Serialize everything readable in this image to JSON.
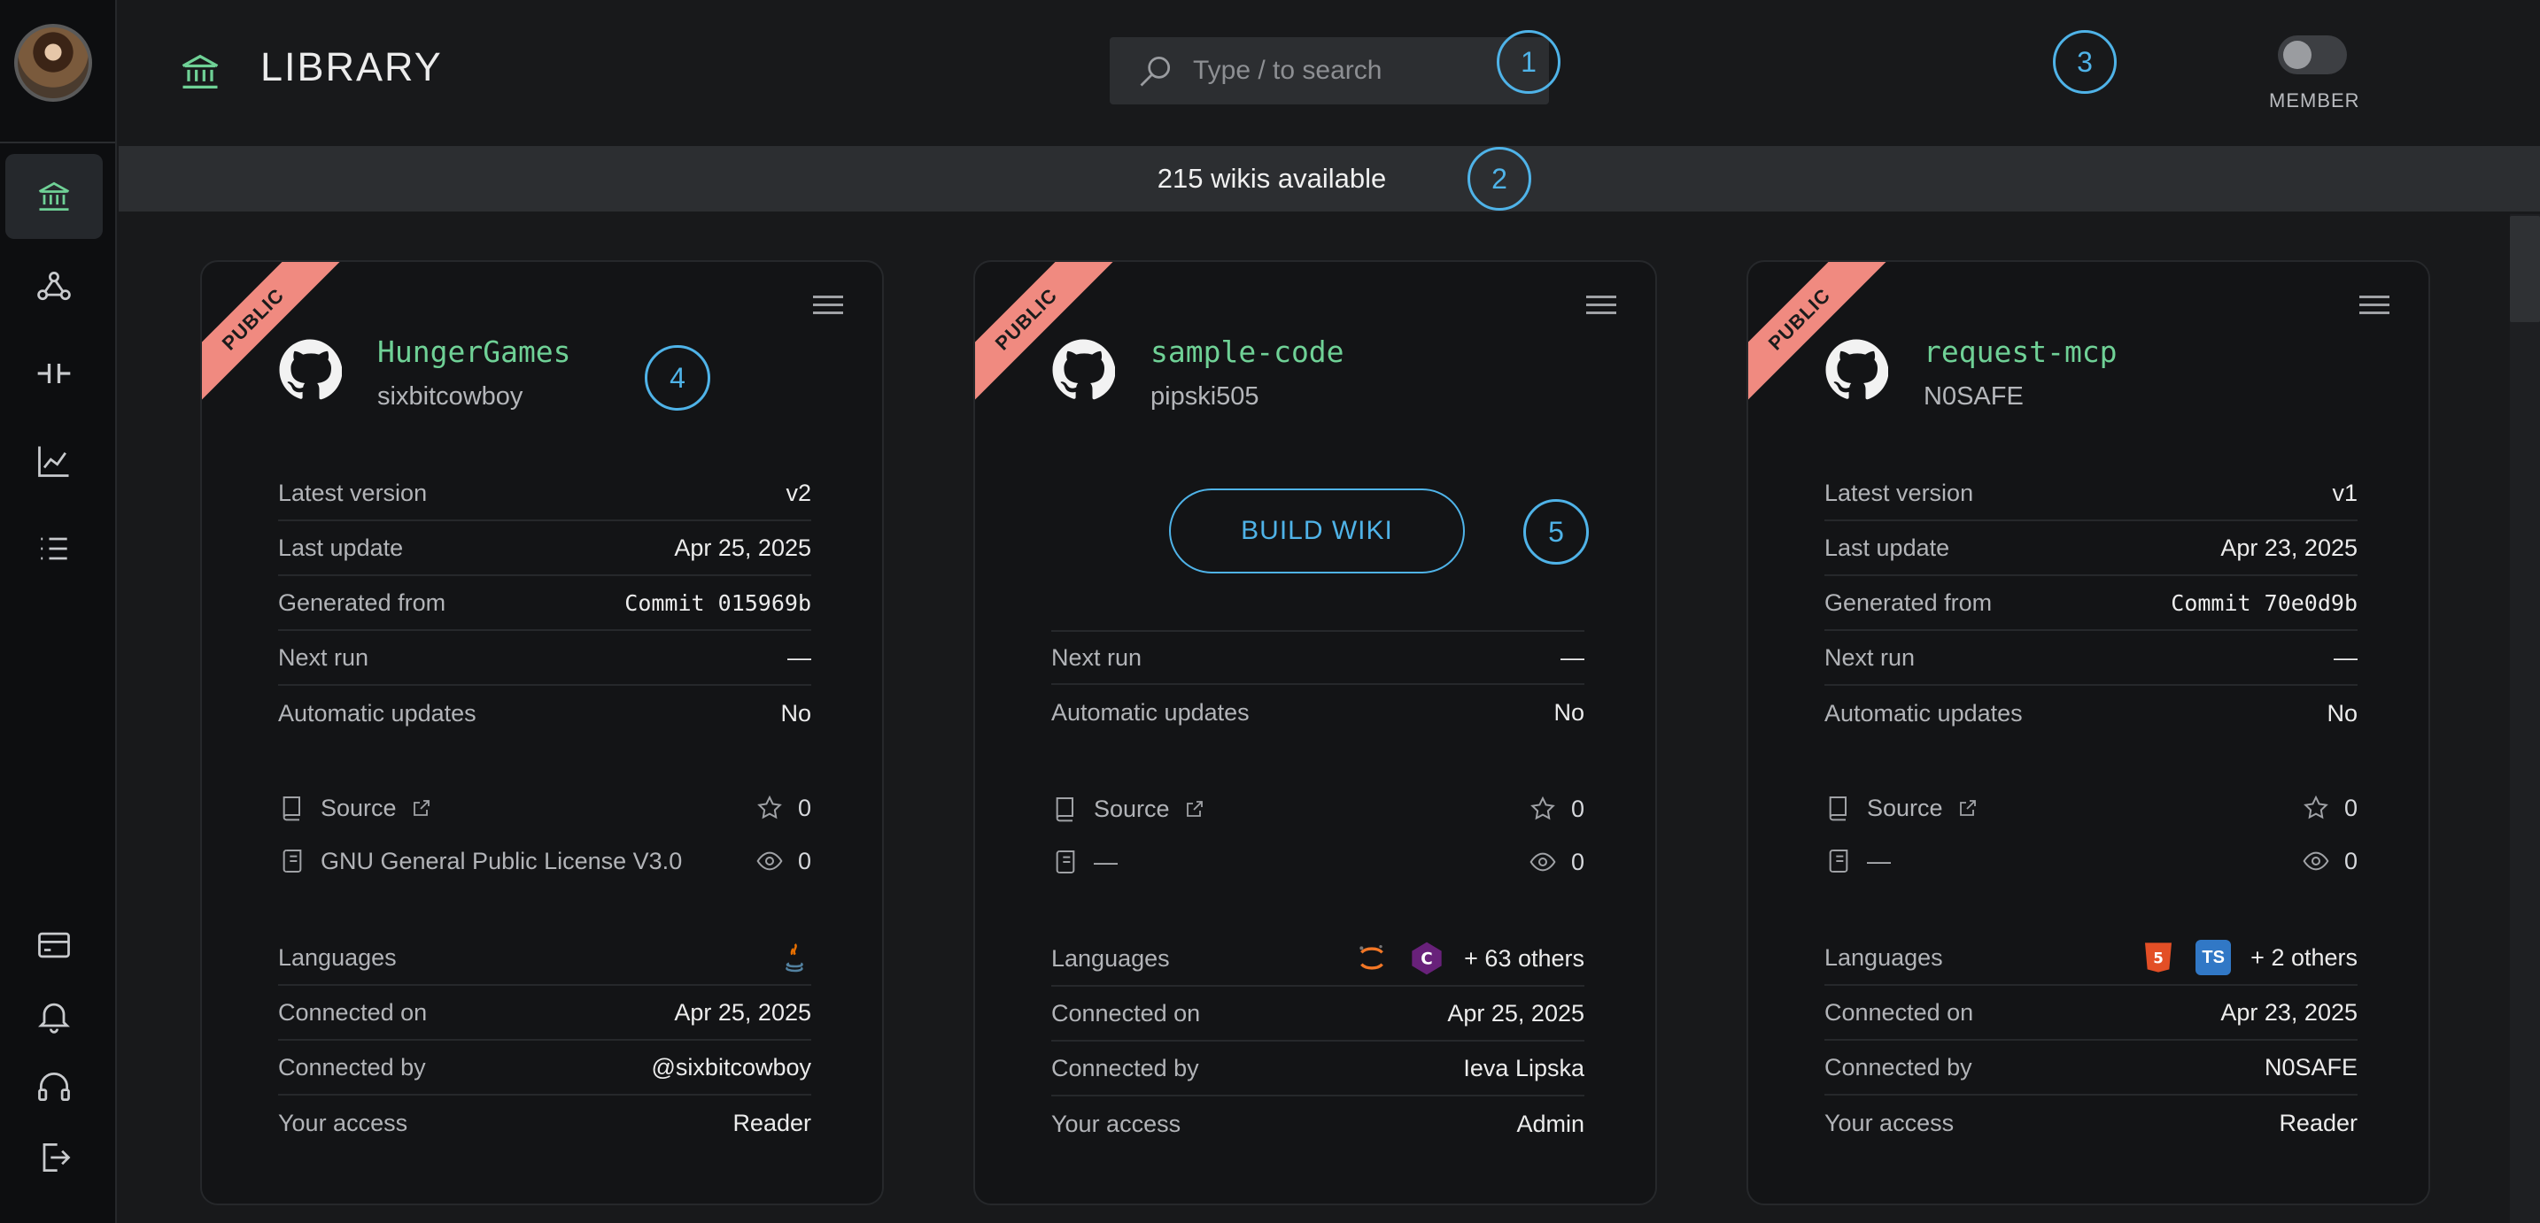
{
  "header": {
    "title": "LIBRARY",
    "search_placeholder": "Type / to search",
    "member_label": "MEMBER"
  },
  "banner": {
    "text": "215 wikis available"
  },
  "markers": [
    "1",
    "2",
    "3",
    "4",
    "5"
  ],
  "labels": {
    "latest_version": "Latest version",
    "last_update": "Last update",
    "generated_from": "Generated from",
    "next_run": "Next run",
    "automatic_updates": "Automatic updates",
    "source": "Source",
    "languages": "Languages",
    "connected_on": "Connected on",
    "connected_by": "Connected by",
    "your_access": "Your access",
    "build_wiki": "BUILD WIKI",
    "public": "PUBLIC"
  },
  "cards": [
    {
      "name": "HungerGames",
      "owner": "sixbitcowboy",
      "latest_version": "v2",
      "last_update": "Apr 25, 2025",
      "generated_from": "Commit 015969b",
      "next_run": "—",
      "automatic_updates": "No",
      "stars": "0",
      "license": "GNU General Public License V3.0",
      "views": "0",
      "languages": [
        "java"
      ],
      "languages_more": "",
      "connected_on": "Apr 25, 2025",
      "connected_by": "@sixbitcowboy",
      "your_access": "Reader"
    },
    {
      "name": "sample-code",
      "owner": "pipski505",
      "next_run": "—",
      "automatic_updates": "No",
      "stars": "0",
      "license": "—",
      "views": "0",
      "languages": [
        "jupyter",
        "csharp"
      ],
      "languages_more": "+ 63 others",
      "connected_on": "Apr 25, 2025",
      "connected_by": "Ieva Lipska",
      "your_access": "Admin"
    },
    {
      "name": "request-mcp",
      "owner": "N0SAFE",
      "latest_version": "v1",
      "last_update": "Apr 23, 2025",
      "generated_from": "Commit 70e0d9b",
      "next_run": "—",
      "automatic_updates": "No",
      "stars": "0",
      "license": "—",
      "views": "0",
      "languages": [
        "html5",
        "typescript"
      ],
      "languages_more": "+ 2 others",
      "connected_on": "Apr 23, 2025",
      "connected_by": "N0SAFE",
      "your_access": "Reader"
    }
  ],
  "colors": {
    "accent_green": "#6fd196",
    "accent_blue": "#4fb3e8",
    "ribbon": "#f08a80"
  }
}
